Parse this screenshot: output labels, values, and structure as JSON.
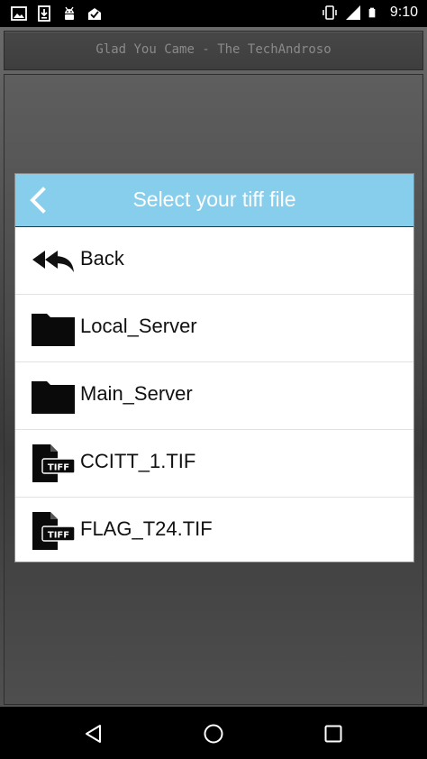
{
  "status_bar": {
    "time": "9:10",
    "left_icons": [
      "image-icon",
      "download-icon",
      "android-icon",
      "inbox-check-icon"
    ],
    "right_icons": [
      "vibrate-icon",
      "signal-icon",
      "battery-icon"
    ]
  },
  "app": {
    "title": "Glad You Came - The TechAndroso"
  },
  "dialog": {
    "title": "Select your tiff file",
    "back_icon": "chevron-left-icon",
    "header_color": "#87cdec",
    "items": [
      {
        "label": "Back",
        "icon": "reply-all-icon"
      },
      {
        "label": "Local_Server",
        "icon": "folder-icon"
      },
      {
        "label": "Main_Server",
        "icon": "folder-icon"
      },
      {
        "label": "CCITT_1.TIF",
        "icon": "tiff-file-icon"
      },
      {
        "label": "FLAG_T24.TIF",
        "icon": "tiff-file-icon"
      }
    ]
  },
  "nav_bar": {
    "buttons": [
      "back-triangle-icon",
      "home-circle-icon",
      "recents-square-icon"
    ]
  }
}
